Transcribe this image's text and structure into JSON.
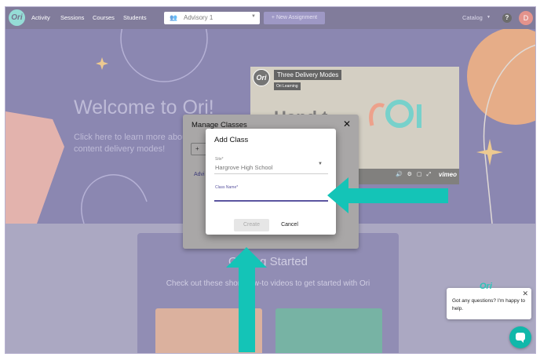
{
  "app": {
    "logo_text": "Ori"
  },
  "nav": {
    "items": [
      "Activity",
      "Sessions",
      "Courses",
      "Students"
    ],
    "advisory": {
      "icon": "group-icon",
      "label": "Advisory 1"
    },
    "new_assignment": "+ New Assignment",
    "catalog": "Catalog",
    "help_icon": "question-mark-icon",
    "user_initial": "D"
  },
  "hero": {
    "title": "Welcome to Ori!",
    "subtitle": "Click here to learn more about content delivery modes!"
  },
  "video": {
    "title": "Three Delivery Modes",
    "subtitle": "Ori Learning",
    "big_text": "Hand t",
    "provider": "vimeo"
  },
  "getting_started": {
    "title": "Getting Started",
    "subtitle": "Check out these short how-to videos to get started with Ori"
  },
  "manage_classes": {
    "title": "Manage Classes",
    "add_label": "+",
    "list_first": "Advi"
  },
  "add_class": {
    "title": "Add Class",
    "site_label": "Site*",
    "site_value": "Hargrove High School",
    "class_name_label": "Class Name*",
    "class_name_value": "",
    "create": "Create",
    "cancel": "Cancel"
  },
  "chat": {
    "message": "Got any questions? I'm happy to help.",
    "logo_text": "Ori"
  },
  "colors": {
    "nav_bg": "#3e3766",
    "hero_bg": "#4e4788",
    "accent": "#5b55a0",
    "teal_arrow": "#14c4b7",
    "chat_button": "#10b8aa"
  }
}
